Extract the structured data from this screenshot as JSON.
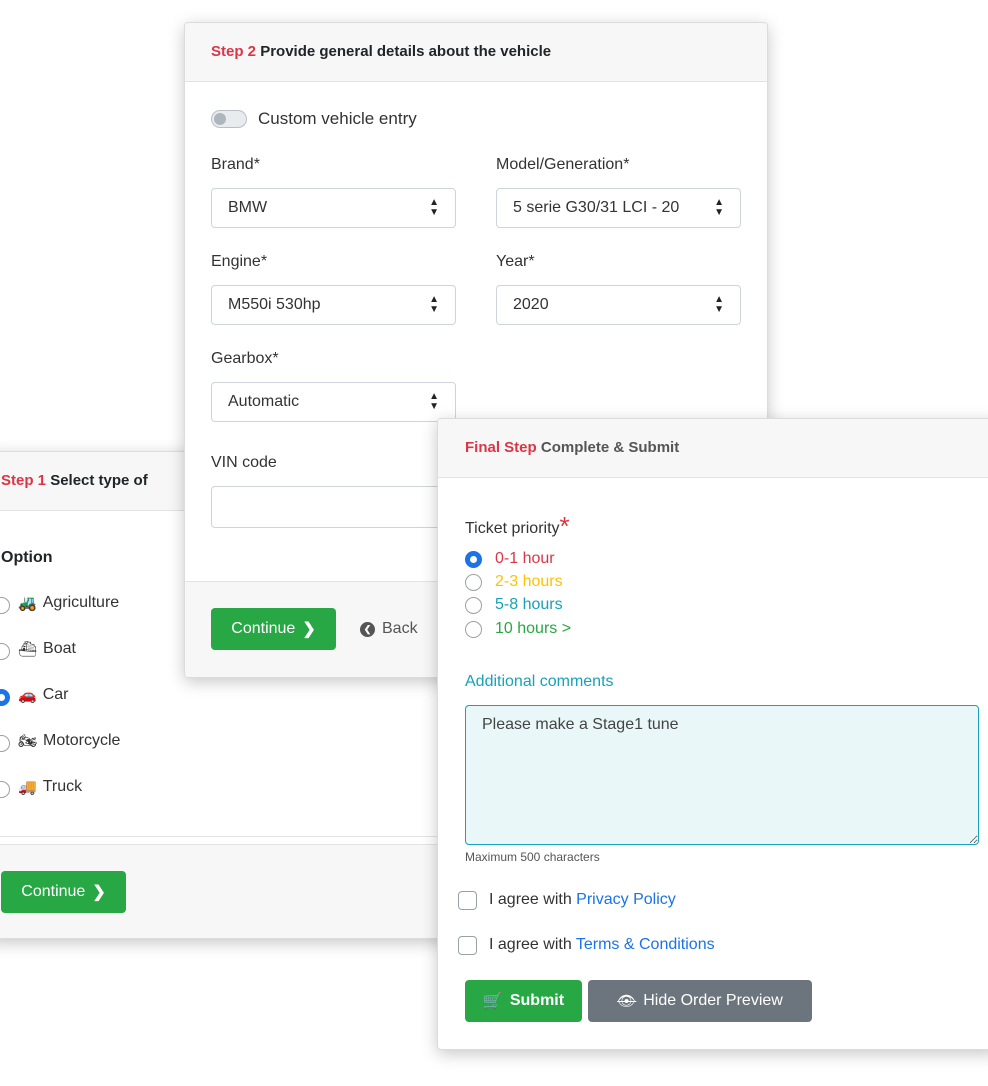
{
  "step1": {
    "step_label": "Step 1",
    "title": "Select type of",
    "option_heading": "Option",
    "options": [
      {
        "label": "Agriculture",
        "icon": "tractor-icon",
        "glyph": "🚜",
        "checked": false
      },
      {
        "label": "Boat",
        "icon": "ship-icon",
        "glyph": "⛴",
        "checked": false
      },
      {
        "label": "Car",
        "icon": "car-icon",
        "glyph": "🚗",
        "checked": true
      },
      {
        "label": "Motorcycle",
        "icon": "motorcycle-icon",
        "glyph": "🏍",
        "checked": false
      },
      {
        "label": "Truck",
        "icon": "truck-icon",
        "glyph": "🚚",
        "checked": false
      }
    ],
    "continue_label": "Continue"
  },
  "step2": {
    "step_label": "Step 2",
    "title": "Provide general details about the vehicle",
    "custom_entry_label": "Custom vehicle entry",
    "custom_entry_on": false,
    "brand": {
      "label": "Brand*",
      "value": "BMW"
    },
    "model": {
      "label": "Model/Generation*",
      "value": "5 serie G30/31 LCI - 20"
    },
    "engine": {
      "label": "Engine*",
      "value": "M550i 530hp"
    },
    "year": {
      "label": "Year*",
      "value": "2020"
    },
    "gearbox": {
      "label": "Gearbox*",
      "value": "Automatic"
    },
    "vin": {
      "label": "VIN code",
      "value": ""
    },
    "continue_label": "Continue",
    "back_label": "Back"
  },
  "final": {
    "step_label": "Final Step",
    "title": "Complete & Submit",
    "priority_label": "Ticket priority",
    "priority_required": "*",
    "priorities": [
      {
        "label": "0-1 hour",
        "color": "#dc3545",
        "checked": true
      },
      {
        "label": "2-3 hours",
        "color": "#ffc107",
        "checked": false
      },
      {
        "label": "5-8 hours",
        "color": "#17a2b8",
        "checked": false
      },
      {
        "label": "10 hours >",
        "color": "#28a745",
        "checked": false
      }
    ],
    "comments_label": "Additional comments",
    "comments_value": "Please make a Stage1 tune",
    "comments_hint": "Maximum 500 characters",
    "privacy_prefix": "I agree with",
    "privacy_link": "Privacy Policy",
    "terms_prefix": "I agree with",
    "terms_link": "Terms & Conditions",
    "submit_label": "Submit",
    "hide_preview_label": "Hide Order Preview"
  },
  "colors": {
    "accent_red": "#dc3545",
    "success": "#28a745",
    "secondary": "#6c757d",
    "info": "#17a2b8",
    "link": "#1a73e8",
    "radio_checked": "#1a73e8"
  }
}
